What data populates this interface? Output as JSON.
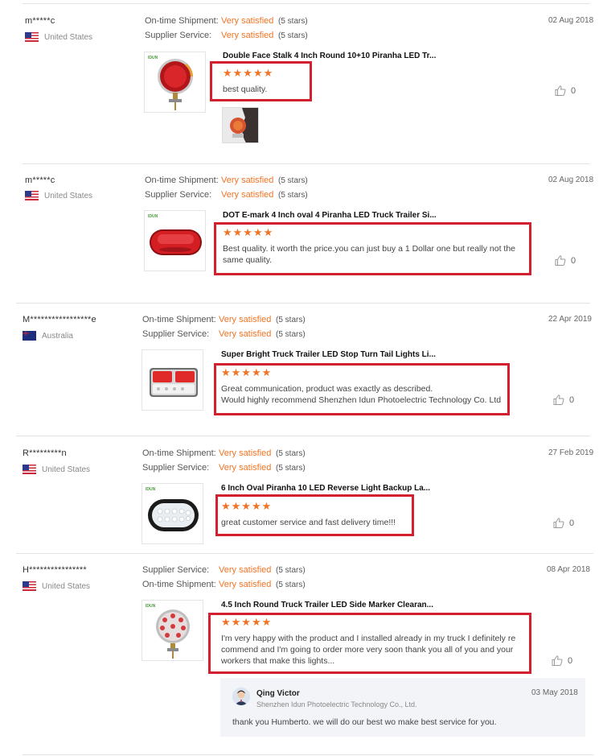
{
  "reviews": [
    {
      "user": "m*****c",
      "country": "United States",
      "flag": "us-flag",
      "ratings": [
        {
          "label": "On-time Shipment:",
          "value": "Very satisfied",
          "stars": "(5 stars)"
        },
        {
          "label": "Supplier Service:",
          "value": "Very satisfied",
          "stars": "(5 stars)"
        }
      ],
      "date": "02 Aug 2018",
      "product_title": "Double Face Stalk 4 Inch Round 10+10 Piranha LED Tr...",
      "star_icons": "★★★★★",
      "rating": 5,
      "text_lines": [
        "best quality."
      ],
      "likes": "0"
    },
    {
      "user": "m*****c",
      "country": "United States",
      "flag": "us-flag",
      "ratings": [
        {
          "label": "On-time Shipment:",
          "value": "Very satisfied",
          "stars": "(5 stars)"
        },
        {
          "label": "Supplier Service:",
          "value": "Very satisfied",
          "stars": "(5 stars)"
        }
      ],
      "date": "02 Aug 2018",
      "product_title": "DOT E-mark 4 Inch oval 4 Piranha LED Truck Trailer Si...",
      "star_icons": "★★★★★",
      "rating": 5,
      "text_lines": [
        "Best quality. it worth the price.you can just buy a 1 Dollar one but really not the",
        "same quality."
      ],
      "likes": "0"
    },
    {
      "user": "M*****************e",
      "country": "Australia",
      "flag": "au-flag",
      "ratings": [
        {
          "label": "On-time Shipment:",
          "value": "Very satisfied",
          "stars": "(5 stars)"
        },
        {
          "label": "Supplier Service:",
          "value": "Very satisfied",
          "stars": "(5 stars)"
        }
      ],
      "date": "22 Apr 2019",
      "product_title": "Super Bright Truck Trailer LED Stop Turn Tail Lights Li...",
      "star_icons": "★★★★★",
      "rating": 5,
      "text_lines": [
        "Great communication, product was exactly as described.",
        "Would highly recommend Shenzhen Idun Photoelectric Technology Co. Ltd"
      ],
      "likes": "0"
    },
    {
      "user": "R*********n",
      "country": "United States",
      "flag": "us-flag",
      "ratings": [
        {
          "label": "On-time Shipment:",
          "value": "Very satisfied",
          "stars": "(5 stars)"
        },
        {
          "label": "Supplier Service:",
          "value": "Very satisfied",
          "stars": "(5 stars)"
        }
      ],
      "date": "27 Feb 2019",
      "product_title": "6 Inch Oval Piranha 10 LED Reverse Light Backup La...",
      "star_icons": "★★★★★",
      "rating": 5,
      "text_lines": [
        "great customer service and fast delivery time!!!"
      ],
      "likes": "0"
    },
    {
      "user": "H****************",
      "country": "United States",
      "flag": "us-flag",
      "ratings": [
        {
          "label": "Supplier Service:",
          "value": "Very satisfied",
          "stars": "(5 stars)"
        },
        {
          "label": "On-time Shipment:",
          "value": "Very satisfied",
          "stars": "(5 stars)"
        }
      ],
      "date": "08 Apr 2018",
      "product_title": "4.5 Inch Round Truck Trailer LED Side Marker Clearan...",
      "star_icons": "★★★★★",
      "rating": 5,
      "text_lines": [
        "I'm very happy with the product and I installed already in my truck I definitely re",
        "commend and I'm going to order more very soon thank you all of you and your",
        "workers that make this lights..."
      ],
      "likes": "0"
    }
  ],
  "brand_mark": "IDUN",
  "reply": {
    "name": "Qing Victor",
    "company": "Shenzhen Idun Photoelectric Technology Co., Ltd.",
    "date": "03 May 2018",
    "text": "thank you Humberto. we will do our best wo make best service for you."
  },
  "colors": {
    "accent_orange": "#f07426",
    "highlight_red": "#d4202e",
    "reply_bg": "#f2f4f7"
  }
}
